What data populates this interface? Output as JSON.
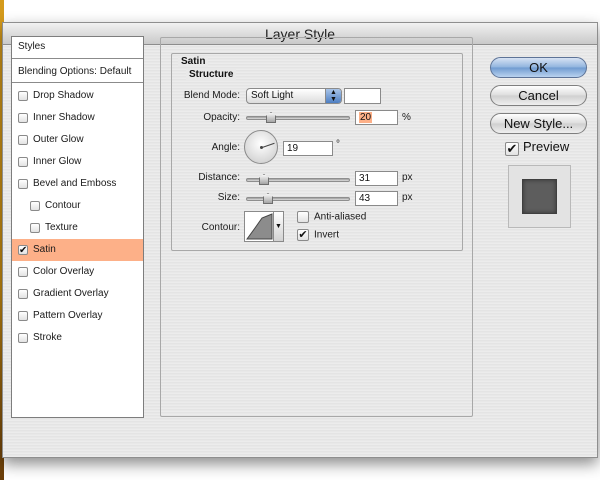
{
  "window": {
    "title": "Layer Style"
  },
  "styles_panel": {
    "header": "Styles",
    "blending_options": "Blending Options: Default",
    "items": [
      {
        "label": "Drop Shadow",
        "checked": false,
        "sub": false,
        "selected": false
      },
      {
        "label": "Inner Shadow",
        "checked": false,
        "sub": false,
        "selected": false
      },
      {
        "label": "Outer Glow",
        "checked": false,
        "sub": false,
        "selected": false
      },
      {
        "label": "Inner Glow",
        "checked": false,
        "sub": false,
        "selected": false
      },
      {
        "label": "Bevel and Emboss",
        "checked": false,
        "sub": false,
        "selected": false
      },
      {
        "label": "Contour",
        "checked": false,
        "sub": true,
        "selected": false
      },
      {
        "label": "Texture",
        "checked": false,
        "sub": true,
        "selected": false
      },
      {
        "label": "Satin",
        "checked": true,
        "sub": false,
        "selected": true
      },
      {
        "label": "Color Overlay",
        "checked": false,
        "sub": false,
        "selected": false
      },
      {
        "label": "Gradient Overlay",
        "checked": false,
        "sub": false,
        "selected": false
      },
      {
        "label": "Pattern Overlay",
        "checked": false,
        "sub": false,
        "selected": false
      },
      {
        "label": "Stroke",
        "checked": false,
        "sub": false,
        "selected": false
      }
    ],
    "selected_color": "#fdb088"
  },
  "satin": {
    "group_title": "Satin",
    "structure_title": "Structure",
    "blend_mode_label": "Blend Mode:",
    "blend_mode_value": "Soft Light",
    "swatch_color": "#ffffff",
    "opacity_label": "Opacity:",
    "opacity_value": "20",
    "opacity_unit": "%",
    "angle_label": "Angle:",
    "angle_value": "19",
    "angle_unit": "°",
    "distance_label": "Distance:",
    "distance_value": "31",
    "distance_unit": "px",
    "size_label": "Size:",
    "size_value": "43",
    "size_unit": "px",
    "contour_label": "Contour:",
    "anti_aliased_label": "Anti-aliased",
    "anti_aliased_checked": false,
    "invert_label": "Invert",
    "invert_checked": true
  },
  "buttons": {
    "ok": "OK",
    "cancel": "Cancel",
    "new_style": "New Style..."
  },
  "preview": {
    "label": "Preview",
    "checked": true
  }
}
